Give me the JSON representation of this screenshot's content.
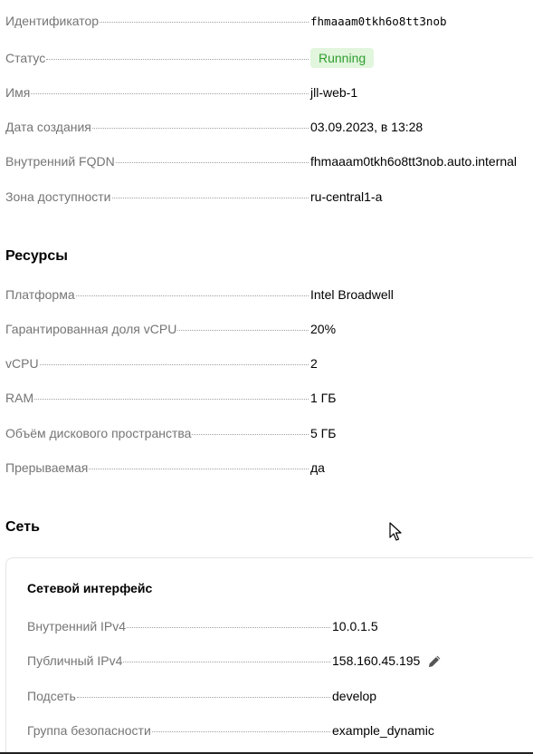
{
  "general": {
    "rows": [
      {
        "label": "Идентификатор",
        "value": "fhmaaam0tkh6o8tt3nob"
      },
      {
        "label": "Статус",
        "value": "Running"
      },
      {
        "label": "Имя",
        "value": "jll-web-1"
      },
      {
        "label": "Дата создания",
        "value": "03.09.2023, в 13:28"
      },
      {
        "label": "Внутренний FQDN",
        "value": "fhmaaam0tkh6o8tt3nob.auto.internal"
      },
      {
        "label": "Зона доступности",
        "value": "ru-central1-a"
      }
    ]
  },
  "resources": {
    "title": "Ресурсы",
    "rows": [
      {
        "label": "Платформа",
        "value": "Intel Broadwell"
      },
      {
        "label": "Гарантированная доля vCPU",
        "value": "20%"
      },
      {
        "label": "vCPU",
        "value": "2"
      },
      {
        "label": "RAM",
        "value": "1 ГБ"
      },
      {
        "label": "Объём дискового пространства",
        "value": "5 ГБ"
      },
      {
        "label": "Прерываемая",
        "value": "да"
      }
    ]
  },
  "network": {
    "title": "Сеть",
    "card": {
      "title": "Сетевой интерфейс",
      "rows": [
        {
          "label": "Внутренний IPv4",
          "value": "10.0.1.5"
        },
        {
          "label": "Публичный IPv4",
          "value": "158.160.45.195"
        },
        {
          "label": "Подсеть",
          "value": "develop"
        },
        {
          "label": "Группа безопасности",
          "value": "example_dynamic"
        }
      ]
    }
  },
  "colors": {
    "status_badge_bg": "#e2f5dd",
    "status_badge_text": "#2f9e2f",
    "link": "#3c6fd1",
    "label": "#757575"
  },
  "icons": {
    "edit": "pencil-icon",
    "pointer": "mouse-cursor-icon"
  }
}
